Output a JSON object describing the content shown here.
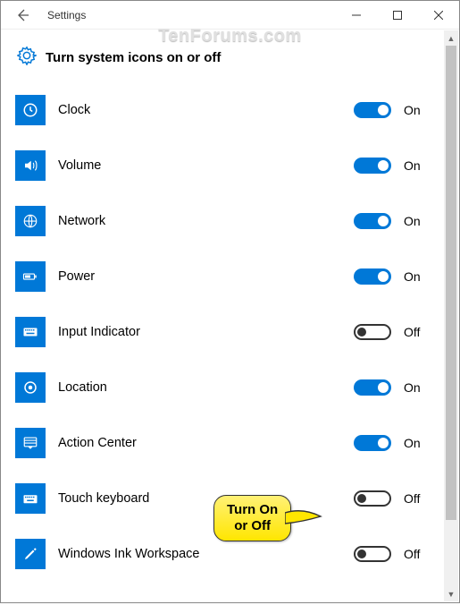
{
  "window": {
    "title": "Settings"
  },
  "watermark": "TenForums.com",
  "page": {
    "title": "Turn system icons on or off"
  },
  "items": [
    {
      "icon": "clock-icon",
      "label": "Clock",
      "on": true,
      "state": "On"
    },
    {
      "icon": "volume-icon",
      "label": "Volume",
      "on": true,
      "state": "On"
    },
    {
      "icon": "network-icon",
      "label": "Network",
      "on": true,
      "state": "On"
    },
    {
      "icon": "power-icon",
      "label": "Power",
      "on": true,
      "state": "On"
    },
    {
      "icon": "keyboard-icon",
      "label": "Input Indicator",
      "on": false,
      "state": "Off"
    },
    {
      "icon": "location-icon",
      "label": "Location",
      "on": true,
      "state": "On"
    },
    {
      "icon": "action-center-icon",
      "label": "Action Center",
      "on": true,
      "state": "On"
    },
    {
      "icon": "touch-keyboard-icon",
      "label": "Touch keyboard",
      "on": false,
      "state": "Off"
    },
    {
      "icon": "pen-icon",
      "label": "Windows Ink Workspace",
      "on": false,
      "state": "Off"
    }
  ],
  "callout": {
    "line1": "Turn On",
    "line2": "or Off"
  }
}
